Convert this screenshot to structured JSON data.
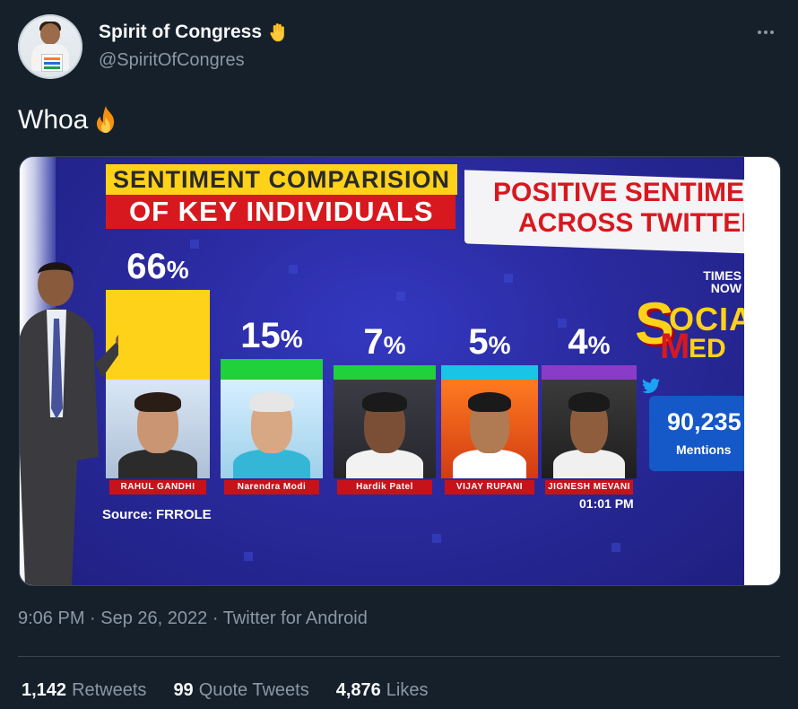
{
  "author": {
    "display_name": "Spirit of Congress",
    "handle": "@SpiritOfCongres"
  },
  "tweet": {
    "text": "Whoa"
  },
  "media": {
    "graphic": {
      "title_line1": "SENTIMENT COMPARISION",
      "title_line2": "OF KEY INDIVIDUALS",
      "subtitle_line1": "POSITIVE SENTIMENT",
      "subtitle_line2": "ACROSS TWITTER",
      "source": "Source: FRROLE",
      "time": "01:01 PM",
      "channel": "TIMES NOW",
      "social_media_letters": {
        "s": "S",
        "ocia": "OCIA",
        "m": "M",
        "ed": "ED"
      },
      "mentions_count": "90,235",
      "mentions_label": "Mentions",
      "colors": {
        "yellow": "#ffd21a",
        "red": "#d7191f",
        "blue_bg": "#2a2a9e",
        "bar_green": "#1fd13a",
        "bar_cyan": "#19c4e6",
        "bar_purple": "#8a3cc8"
      }
    },
    "chart_data": {
      "type": "bar",
      "title": "SENTIMENT COMPARISION OF KEY INDIVIDUALS",
      "subtitle": "POSITIVE SENTIMENT ACROSS TWITTER",
      "categories": [
        "RAHUL GANDHI",
        "Narendra Modi",
        "Hardik Patel",
        "VIJAY RUPANI",
        "JIGNESH MEVANI"
      ],
      "values": [
        66,
        15,
        7,
        5,
        4
      ],
      "value_labels": [
        "66",
        "15",
        "7",
        "5",
        "4"
      ],
      "unit": "%",
      "ylim": [
        0,
        66
      ]
    }
  },
  "meta": {
    "time": "9:06 PM",
    "date": "Sep 26, 2022",
    "source": "Twitter for Android"
  },
  "stats": {
    "retweets_count": "1,142",
    "retweets_label": "Retweets",
    "quotes_count": "99",
    "quotes_label": "Quote Tweets",
    "likes_count": "4,876",
    "likes_label": "Likes"
  }
}
